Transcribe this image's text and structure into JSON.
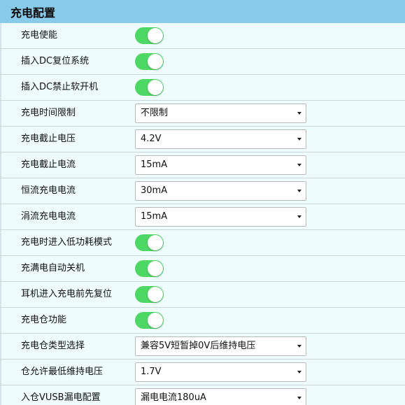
{
  "header": {
    "title": "充电配置"
  },
  "rows": [
    {
      "label": "充电使能",
      "type": "toggle",
      "on": true
    },
    {
      "label": "插入DC复位系统",
      "type": "toggle",
      "on": true
    },
    {
      "label": "插入DC禁止软开机",
      "type": "toggle",
      "on": true
    },
    {
      "label": "充电时间限制",
      "type": "select",
      "value": "不限制"
    },
    {
      "label": "充电截止电压",
      "type": "select",
      "value": "4.2V"
    },
    {
      "label": "充电截止电流",
      "type": "select",
      "value": "15mA"
    },
    {
      "label": "恒流充电电流",
      "type": "select",
      "value": "30mA"
    },
    {
      "label": "涓流充电电流",
      "type": "select",
      "value": "15mA"
    },
    {
      "label": "充电时进入低功耗模式",
      "type": "toggle",
      "on": true
    },
    {
      "label": "充满电自动关机",
      "type": "toggle",
      "on": true
    },
    {
      "label": "耳机进入充电前先复位",
      "type": "toggle",
      "on": true
    },
    {
      "label": "充电仓功能",
      "type": "toggle",
      "on": true
    },
    {
      "label": "充电仓类型选择",
      "type": "select",
      "value": "兼容5V短暂掉0V后维持电压"
    },
    {
      "label": "仓允许最低维持电压",
      "type": "select",
      "value": "1.7V"
    },
    {
      "label": "入仓VUSB漏电配置",
      "type": "select",
      "value": "漏电电流180uA"
    }
  ],
  "colors": {
    "header_bg": "#87cae9",
    "panel_bg": "#eefcfd",
    "toggle_on": "#4dd865"
  }
}
